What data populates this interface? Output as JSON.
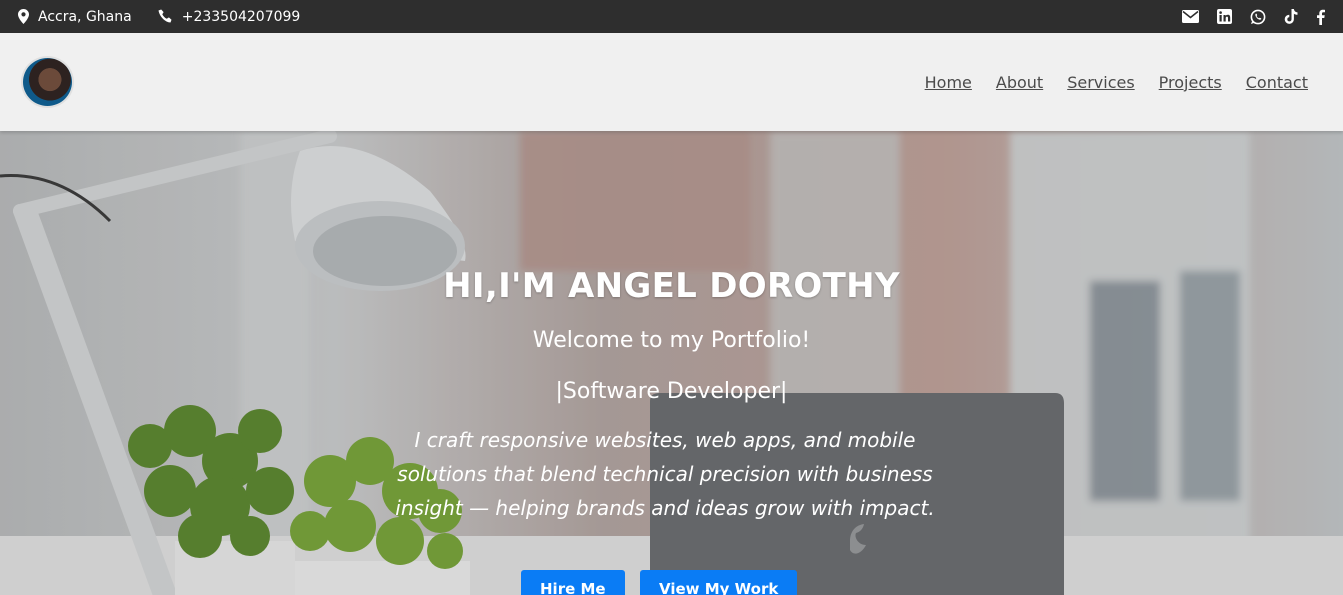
{
  "topbar": {
    "location": "Accra, Ghana",
    "phone": "+233504207099",
    "social": [
      "envelope-icon",
      "linkedin-icon",
      "whatsapp-icon",
      "tiktok-icon",
      "facebook-icon"
    ]
  },
  "nav": {
    "items": [
      {
        "label": "Home"
      },
      {
        "label": "About"
      },
      {
        "label": "Services"
      },
      {
        "label": "Projects"
      },
      {
        "label": "Contact"
      }
    ]
  },
  "hero": {
    "title": "HI,I'M ANGEL DOROTHY",
    "welcome": "Welcome to my Portfolio!",
    "role": "|Software Developer|",
    "description": "I craft responsive websites, web apps, and mobile solutions that blend technical precision with business insight — helping brands and ideas grow with impact.",
    "buttons": {
      "hire": "Hire Me",
      "work": "View My Work"
    }
  },
  "colors": {
    "topbar": "#2e2e2e",
    "header": "#f0f0f0",
    "accent": "#0a7cf5",
    "nav_text": "#4b4b4b"
  }
}
